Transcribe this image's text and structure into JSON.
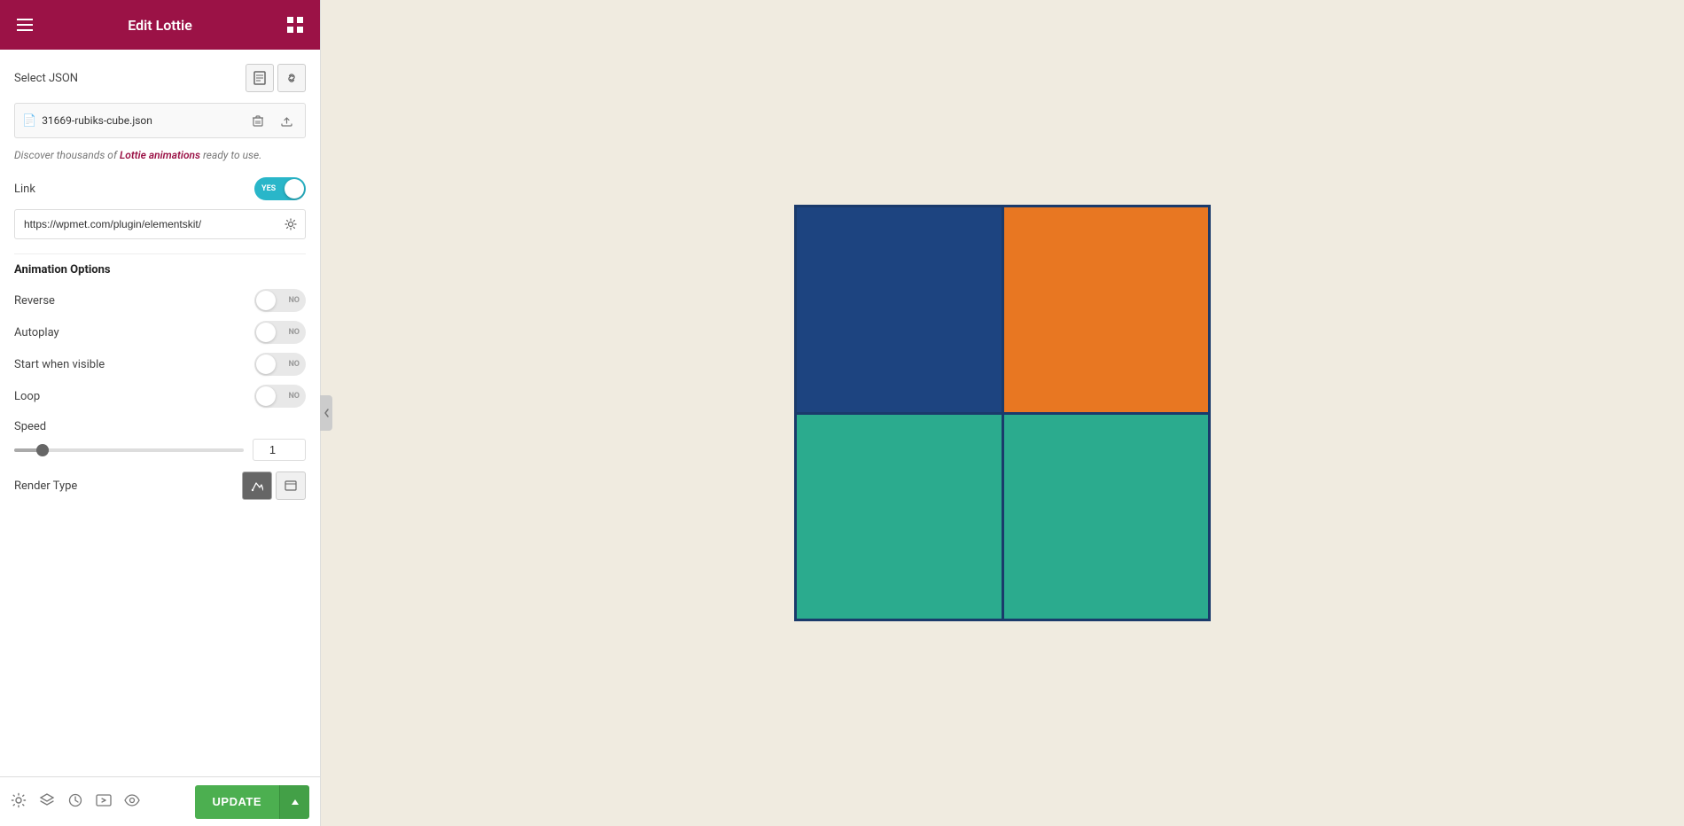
{
  "header": {
    "title": "Edit Lottie",
    "hamburger_icon": "≡",
    "grid_icon": "⠿"
  },
  "sidebar": {
    "select_json_label": "Select JSON",
    "file_icon": "📄",
    "file_name": "31669-rubiks-cube.json",
    "promo_text_before": "Discover thousands of ",
    "promo_link": "Lottie animations",
    "promo_text_after": " ready to use.",
    "link_label": "Link",
    "link_toggle": "YES",
    "url_value": "https://wpmet.com/plugin/elementskit/",
    "animation_options_title": "Animation Options",
    "reverse_label": "Reverse",
    "reverse_value": "NO",
    "autoplay_label": "Autoplay",
    "autoplay_value": "NO",
    "start_when_visible_label": "Start when visible",
    "start_when_visible_value": "NO",
    "loop_label": "Loop",
    "loop_value": "NO",
    "speed_label": "Speed",
    "speed_value": "1",
    "render_type_label": "Render Type",
    "render_svg_icon": "✏",
    "render_canvas_icon": "🖼"
  },
  "footer": {
    "update_label": "UPDATE",
    "arrow_label": "▲"
  },
  "canvas": {
    "quad_colors": [
      "#1d4480",
      "#e87722",
      "#2bab8e",
      "#2bab8e"
    ],
    "border_color": "#1a3a6b"
  }
}
